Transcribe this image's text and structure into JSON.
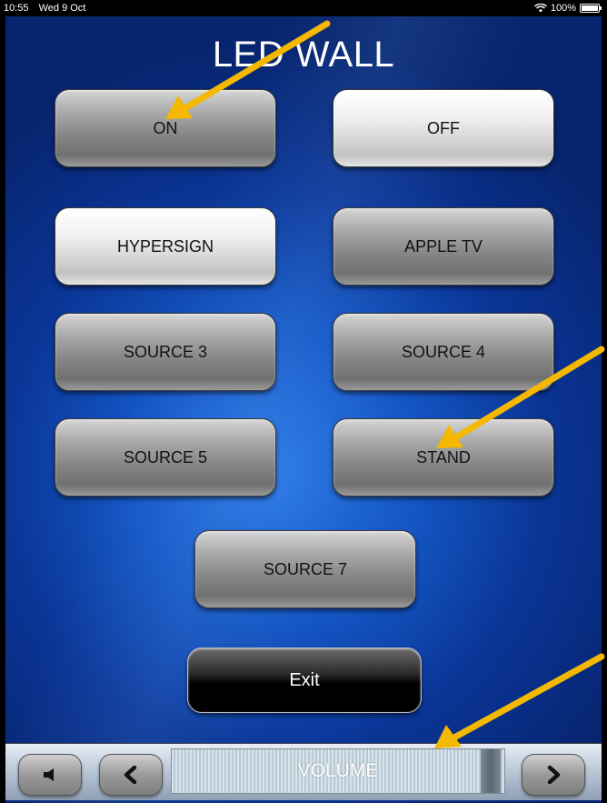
{
  "status_bar": {
    "time": "10:55",
    "date": "Wed 9 Oct",
    "battery": "100%"
  },
  "title": "LED WALL",
  "buttons": {
    "on": "ON",
    "off": "OFF",
    "hypersign": "HYPERSIGN",
    "apple_tv": "APPLE TV",
    "source3": "SOURCE 3",
    "source4": "SOURCE 4",
    "source5": "SOURCE 5",
    "stand": "STAND",
    "source7": "SOURCE 7",
    "exit": "Exit"
  },
  "volume": {
    "label": "VOLUME"
  },
  "colors": {
    "arrow": "#f5b800",
    "background": "#1456c4"
  }
}
